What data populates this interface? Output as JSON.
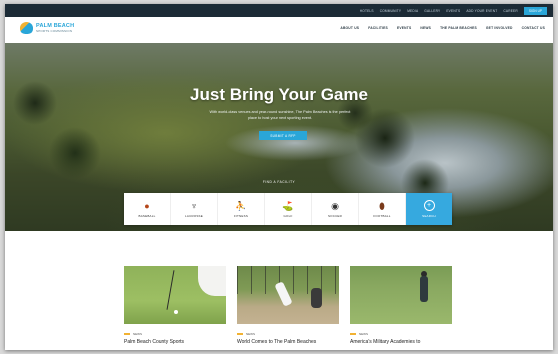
{
  "top_nav": {
    "links": [
      "HOTELS",
      "COMMUNITY",
      "MEDIA",
      "GALLERY",
      "EVENTS",
      "ADD YOUR EVENT",
      "CAREER"
    ],
    "cta": "SIGN UP"
  },
  "logo": {
    "line1": "PALM BEACH",
    "line2": "SPORTS COMMISSION"
  },
  "main_nav": [
    "ABOUT US",
    "FACILITIES",
    "EVENTS",
    "NEWS",
    "THE PALM BEACHES",
    "GET INVOLVED",
    "CONTACT US"
  ],
  "hero": {
    "title": "Just Bring Your Game",
    "subtitle": "With world-class venues and year-round sunshine, The Palm Beaches is the perfect place to host your next sporting event.",
    "button": "SUBMIT A RFP"
  },
  "find_label": "FIND A FACILITY",
  "sports": [
    {
      "label": "BASEBALL",
      "icon": "baseball-icon",
      "glyph": "●",
      "color": "#b5471b"
    },
    {
      "label": "LACROSSE",
      "icon": "lacrosse-icon",
      "glyph": "♆",
      "color": "#333333"
    },
    {
      "label": "FITNESS",
      "icon": "fitness-icon",
      "glyph": "⛹",
      "color": "#555555"
    },
    {
      "label": "GOLF",
      "icon": "golf-icon",
      "glyph": "⛳",
      "color": "#444444"
    },
    {
      "label": "SOCCER",
      "icon": "soccer-icon",
      "glyph": "◉",
      "color": "#444444"
    },
    {
      "label": "FOOTBALL",
      "icon": "football-icon",
      "glyph": "⬮",
      "color": "#7a3b1b"
    },
    {
      "label": "SEARCH",
      "icon": "search-all-icon",
      "glyph": "+",
      "color": "#ffffff"
    }
  ],
  "cards": [
    {
      "tag": "NEWS",
      "title": "Palm Beach County Sports"
    },
    {
      "tag": "NEWS",
      "title": "World Comes to The Palm Beaches"
    },
    {
      "tag": "NEWS",
      "title": "America's Military Academies to"
    }
  ],
  "colors": {
    "accent": "#2aa6d8",
    "topbar": "#1c2b36",
    "tag_bar": "#f2b233"
  }
}
